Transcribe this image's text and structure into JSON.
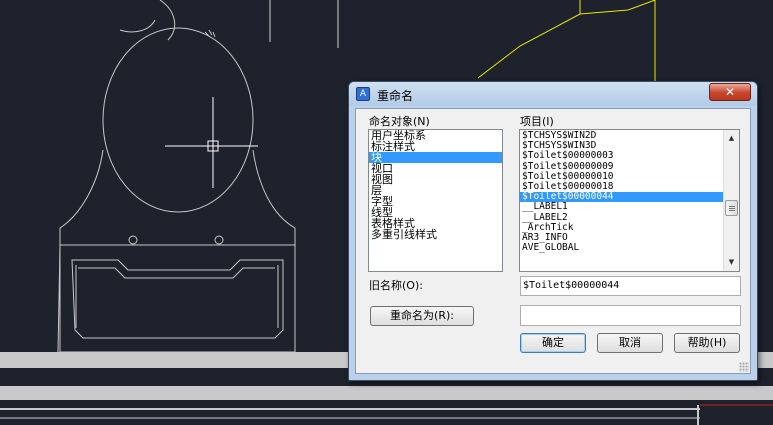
{
  "dialog": {
    "title": "重命名",
    "close_label": "✕",
    "objects_label": "命名对象(N)",
    "items_label": "项目(I)",
    "old_name_label": "旧名称(O):",
    "rename_to_label": "重命名为(R):",
    "old_name_value": "$Toilet$00000044",
    "rename_to_value": "",
    "objects": [
      {
        "label": "用户坐标系",
        "selected": false
      },
      {
        "label": "标注样式",
        "selected": false
      },
      {
        "label": "块",
        "selected": true
      },
      {
        "label": "视口",
        "selected": false
      },
      {
        "label": "视图",
        "selected": false
      },
      {
        "label": "层",
        "selected": false
      },
      {
        "label": "字型",
        "selected": false
      },
      {
        "label": "线型",
        "selected": false
      },
      {
        "label": "表格样式",
        "selected": false
      },
      {
        "label": "多重引线样式",
        "selected": false
      }
    ],
    "items": [
      {
        "label": "$TCHSYS$WIN2D",
        "selected": false
      },
      {
        "label": "$TCHSYS$WIN3D",
        "selected": false
      },
      {
        "label": "$Toilet$00000003",
        "selected": false
      },
      {
        "label": "$Toilet$00000009",
        "selected": false
      },
      {
        "label": "$Toilet$00000010",
        "selected": false
      },
      {
        "label": "$Toilet$00000018",
        "selected": false
      },
      {
        "label": "$Toilet$00000044",
        "selected": true
      },
      {
        "label": "__LABEL1",
        "selected": false
      },
      {
        "label": "__LABEL2",
        "selected": false
      },
      {
        "label": "_ArchTick",
        "selected": false
      },
      {
        "label": "AR3_INFO",
        "selected": false
      },
      {
        "label": "AVE_GLOBAL",
        "selected": false
      }
    ],
    "buttons": {
      "ok": "确定",
      "cancel": "取消",
      "help": "帮助(H)"
    }
  },
  "colors": {
    "canvas_bg": "#1e222d",
    "selection": "#3399ff",
    "cad_line": "#c8c8c8",
    "cad_yellow": "#e6e600",
    "cad_red": "#c81e1e"
  }
}
